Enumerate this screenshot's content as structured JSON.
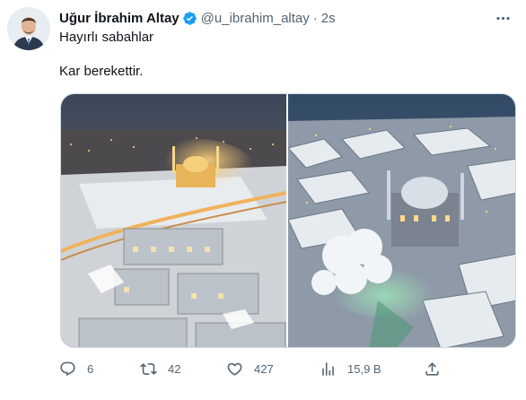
{
  "author": {
    "name": "Uğur İbrahim Altay",
    "handle": "@u_ibrahim_altay",
    "separator": "·",
    "time": "2s"
  },
  "tweet": {
    "line1": "Hayırlı sabahlar",
    "line2": "Kar berekettir."
  },
  "stats": {
    "replies": "6",
    "retweets": "42",
    "likes": "427",
    "views": "15,9 B"
  },
  "icons": {
    "verified": "verified-badge-icon",
    "more": "more-dots-icon",
    "reply": "reply-icon",
    "retweet": "retweet-icon",
    "like": "heart-icon",
    "views": "views-bar-icon",
    "share": "share-icon"
  },
  "colors": {
    "verified_blue": "#1d9bf0",
    "muted_text": "#536471",
    "primary_text": "#0f1419"
  }
}
